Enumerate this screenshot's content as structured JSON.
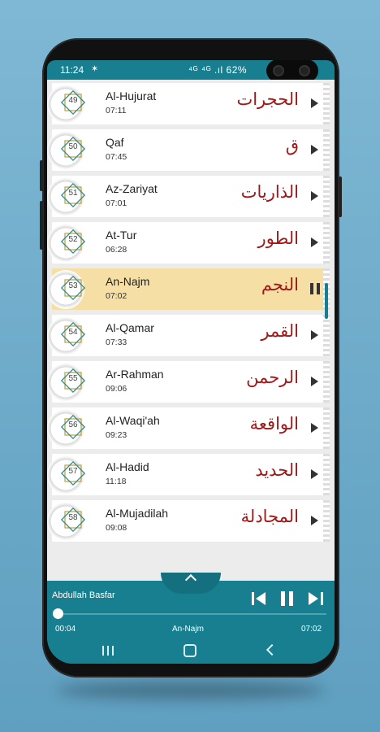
{
  "status": {
    "time": "11:24",
    "right": "⁴ᴳ ⁴ᴳ .ıl 62%"
  },
  "colors": {
    "accent": "#177f8f",
    "active_row": "#f6dfa4",
    "arabic": "#a21818"
  },
  "surahs": [
    {
      "num": "49",
      "name": "Al-Hujurat",
      "duration": "07:11",
      "arabic": "الحجرات",
      "state": "play"
    },
    {
      "num": "50",
      "name": "Qaf",
      "duration": "07:45",
      "arabic": "ق",
      "state": "play"
    },
    {
      "num": "51",
      "name": "Az-Zariyat",
      "duration": "07:01",
      "arabic": "الذاريات",
      "state": "play"
    },
    {
      "num": "52",
      "name": "At-Tur",
      "duration": "06:28",
      "arabic": "الطور",
      "state": "play"
    },
    {
      "num": "53",
      "name": "An-Najm",
      "duration": "07:02",
      "arabic": "النجم",
      "state": "pause"
    },
    {
      "num": "54",
      "name": "Al-Qamar",
      "duration": "07:33",
      "arabic": "القمر",
      "state": "play"
    },
    {
      "num": "55",
      "name": "Ar-Rahman",
      "duration": "09:06",
      "arabic": "الرحمن",
      "state": "play"
    },
    {
      "num": "56",
      "name": "Al-Waqi'ah",
      "duration": "09:23",
      "arabic": "الواقعة",
      "state": "play"
    },
    {
      "num": "57",
      "name": "Al-Hadid",
      "duration": "11:18",
      "arabic": "الحديد",
      "state": "play"
    },
    {
      "num": "58",
      "name": "Al-Mujadilah",
      "duration": "09:08",
      "arabic": "المجادلة",
      "state": "play"
    }
  ],
  "player": {
    "reciter": "Abdullah Basfar",
    "current_time": "00:04",
    "title": "An-Najm",
    "total_time": "07:02",
    "progress": 0.01
  },
  "icons": {
    "status_star": "star-icon",
    "expand": "chevron-up-icon",
    "prev": "skip-previous-icon",
    "pause": "pause-icon",
    "next": "skip-next-icon",
    "row_play": "play-icon",
    "row_pause": "pause-icon",
    "nav_recents": "recents-icon",
    "nav_home": "home-icon",
    "nav_back": "back-icon"
  }
}
